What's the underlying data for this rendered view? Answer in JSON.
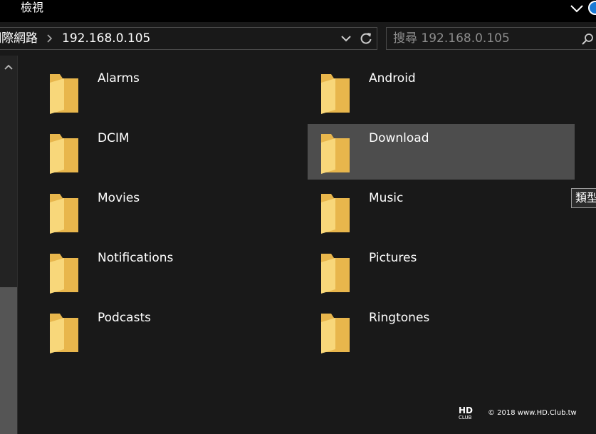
{
  "ribbon": {
    "tab_label": "檢視"
  },
  "address": {
    "root_label": "網際網路",
    "current": "192.168.0.105"
  },
  "search": {
    "placeholder": "搜尋 192.168.0.105"
  },
  "items": [
    {
      "name": "Alarms",
      "selected": false
    },
    {
      "name": "Android",
      "selected": false
    },
    {
      "name": "DCIM",
      "selected": false
    },
    {
      "name": "Download",
      "selected": true
    },
    {
      "name": "Movies",
      "selected": false
    },
    {
      "name": "Music",
      "selected": false
    },
    {
      "name": "Notifications",
      "selected": false
    },
    {
      "name": "Pictures",
      "selected": false
    },
    {
      "name": "Podcasts",
      "selected": false
    },
    {
      "name": "Ringtones",
      "selected": false
    }
  ],
  "tooltip": {
    "text": "類型"
  },
  "watermark": {
    "logo_text": "HD CLUB",
    "text": "© 2018 www.HD.Club.tw"
  },
  "colors": {
    "folder_back": "#e8b64c",
    "folder_front": "#f8d77a",
    "selection": "#4d4d4d",
    "accent": "#1a7ad4"
  }
}
